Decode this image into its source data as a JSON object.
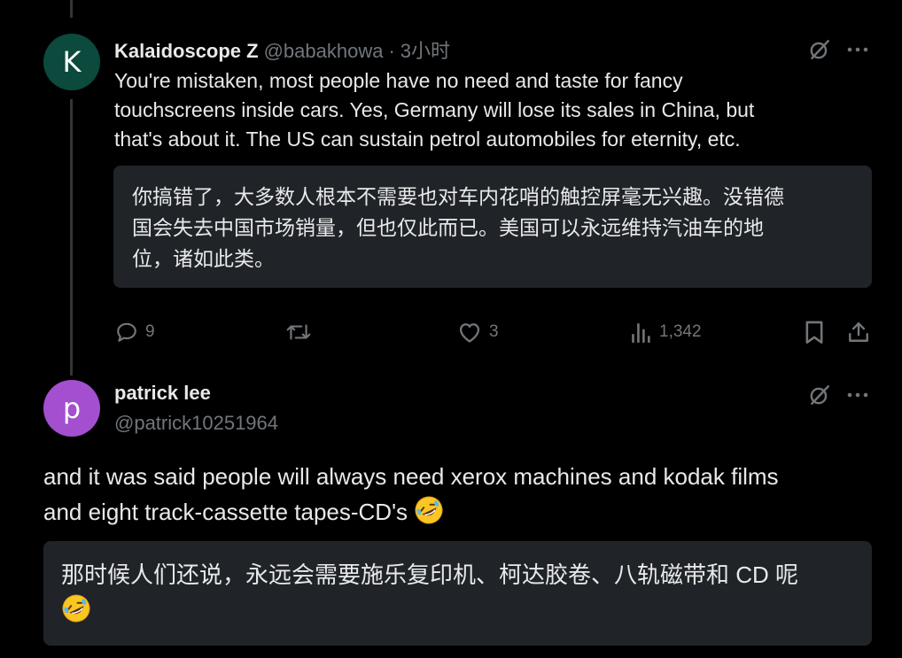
{
  "reply1": {
    "avatar_letter": "K",
    "avatar_color": "#0b4a3c",
    "display_name": "Kalaidoscope Z",
    "handle": "@babakhowa",
    "separator": "·",
    "time": "3小时",
    "text_lines": [
      "You're mistaken, most people have no need and taste for fancy",
      "touchscreens inside cars. Yes, Germany will lose its sales in China, but",
      "that's about it. The US can sustain petrol automobiles for eternity, etc."
    ],
    "translation_lines": [
      "你搞错了，大多数人根本不需要也对车内花哨的触控屏毫无兴趣。没错德",
      "国会失去中国市场销量，但也仅此而已。美国可以永远维持汽油车的地",
      "位，诸如此类。"
    ],
    "actions": {
      "reply_count": "9",
      "retweet_count": "",
      "like_count": "3",
      "view_count": "1,342"
    }
  },
  "reply2": {
    "avatar_letter": "p",
    "avatar_color": "#a34fcf",
    "display_name": "patrick lee",
    "handle": "@patrick10251964",
    "text_line1": "and it was said people will always need xerox machines and kodak films",
    "text_line2": "and eight track-cassette tapes-CD's",
    "translation_line1": "那时候人们还说，永远会需要施乐复印机、柯达胶卷、八轨磁带和 CD 呢"
  },
  "icons": {
    "grok": "grok-slash-icon",
    "more": "more-dots-icon",
    "reply": "reply-bubble-icon",
    "retweet": "retweet-icon",
    "like": "heart-icon",
    "views": "views-bars-icon",
    "bookmark": "bookmark-icon",
    "share": "share-upload-icon",
    "emoji": "rolling-laughing-emoji"
  }
}
